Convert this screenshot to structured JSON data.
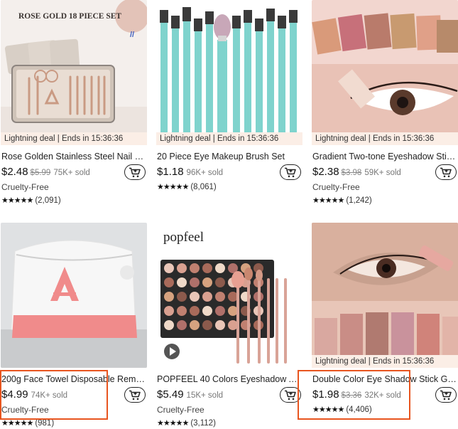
{
  "products": [
    {
      "id": "nail",
      "overlay": "ROSE GOLD 18 PIECE SET",
      "deal": "Lightning deal | Ends in 15:36:36",
      "title": "Rose Golden Stainless Steel Nail Clip...",
      "price": "$2.48",
      "orig": "$5.99",
      "sold": "75K+ sold",
      "badge": "Cruelty-Free",
      "stars": "★★★★★",
      "count": "(2,091)"
    },
    {
      "id": "brush",
      "deal": "Lightning deal | Ends in 15:36:36",
      "title": "20 Piece Eye Makeup Brush Set",
      "price": "$1.18",
      "sold": "96K+ sold",
      "stars": "★★★★★",
      "count": "(8,061)"
    },
    {
      "id": "gradient",
      "deal": "Lightning deal | Ends in 15:36:36",
      "title": "Gradient Two-tone Eyeshadow Stick ...",
      "price": "$2.38",
      "orig": "$3.98",
      "sold": "59K+ sold",
      "badge": "Cruelty-Free",
      "stars": "★★★★★",
      "count": "(1,242)"
    },
    {
      "id": "towel",
      "title": "200g Face Towel Disposable Remov...",
      "price": "$4.99",
      "sold": "74K+ sold",
      "badge": "Cruelty-Free",
      "stars": "★★★★★",
      "count": "(981)"
    },
    {
      "id": "popfeel",
      "brand": "popfeel",
      "title": "POPFEEL 40 Colors Eyeshadow And ...",
      "price": "$5.49",
      "sold": "15K+ sold",
      "badge": "Cruelty-Free",
      "stars": "★★★★★",
      "count": "(3,112)"
    },
    {
      "id": "double",
      "deal": "Lightning deal | Ends in 15:36:36",
      "title": "Double Color Eye Shadow Stick Gra...",
      "price": "$1.98",
      "orig": "$3.36",
      "sold": "32K+ sold",
      "stars": "★★★★★",
      "count": "(4,406)"
    }
  ],
  "colors": {
    "highlight": "#e8551f",
    "deal_bg": "#fbeee6",
    "teal": "#7fd3cd",
    "rose": "#e8b8a8"
  }
}
